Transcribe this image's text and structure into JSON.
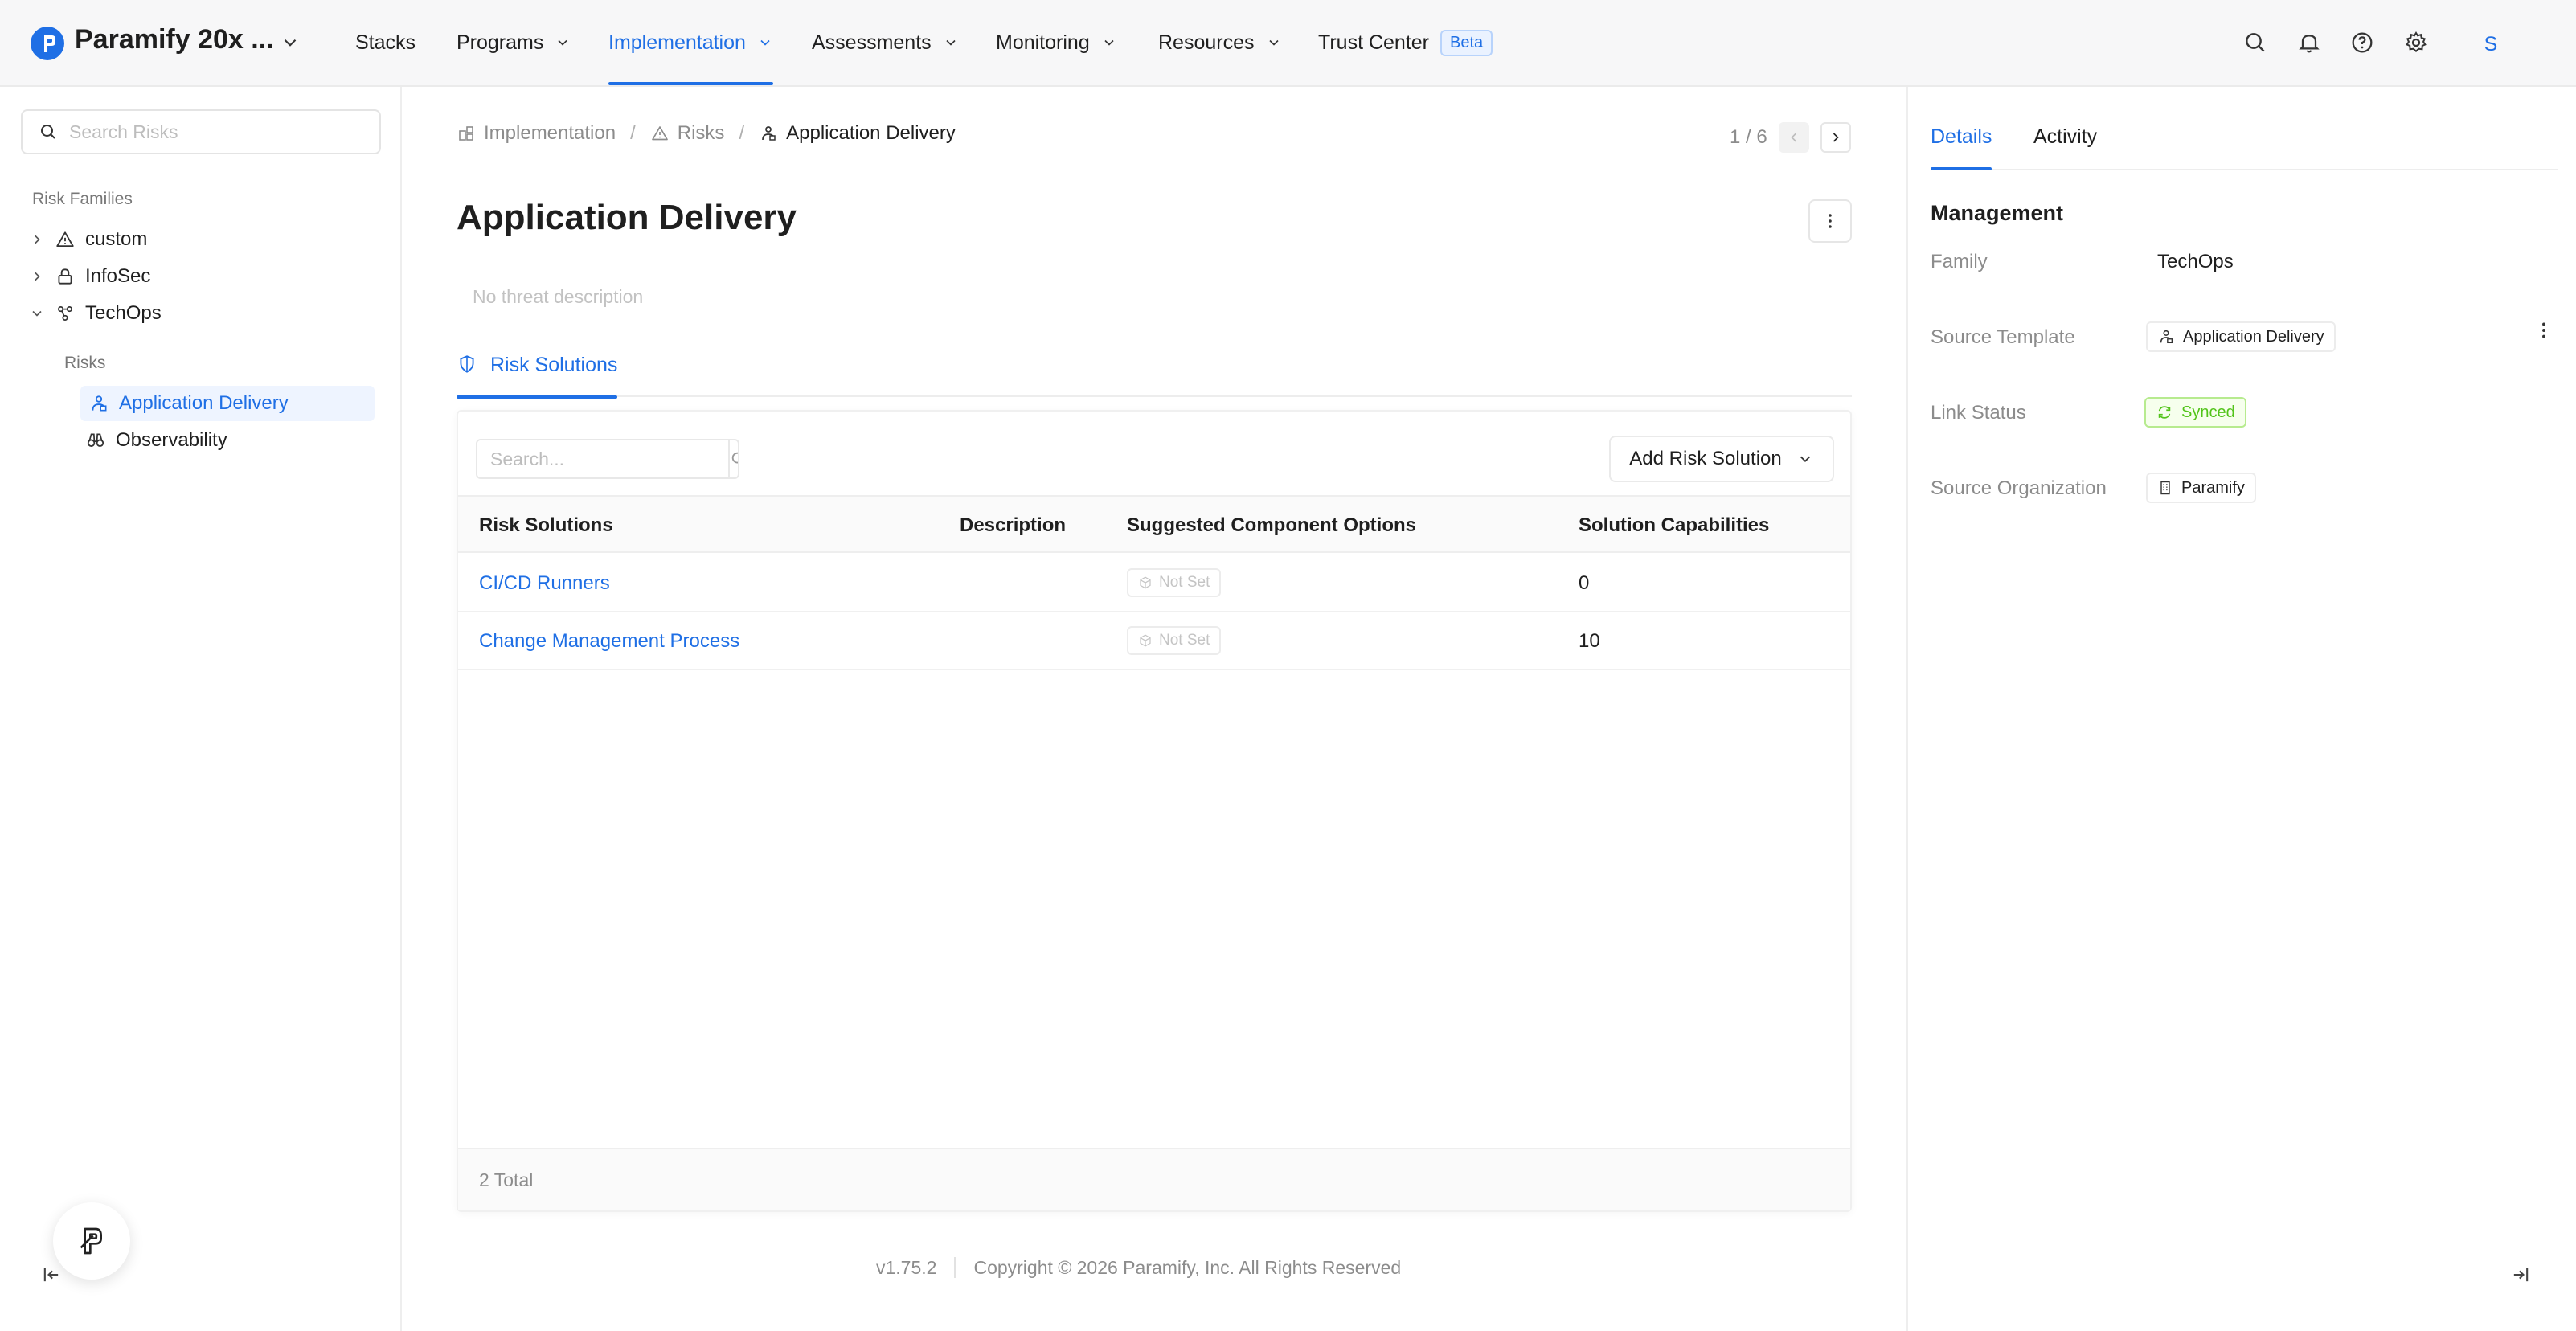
{
  "topnav": {
    "org_name": "Paramify 20x ...",
    "items": [
      {
        "label": "Stacks",
        "has_chevron": false
      },
      {
        "label": "Programs",
        "has_chevron": true
      },
      {
        "label": "Implementation",
        "has_chevron": true,
        "active": true
      },
      {
        "label": "Assessments",
        "has_chevron": true
      },
      {
        "label": "Monitoring",
        "has_chevron": true
      },
      {
        "label": "Resources",
        "has_chevron": true
      },
      {
        "label": "Trust Center",
        "badge": "Beta"
      }
    ],
    "icons": [
      "search-icon",
      "bell-icon",
      "help-icon",
      "gear-icon"
    ],
    "avatar_initial": "S"
  },
  "sidebar": {
    "search_placeholder": "Search Risks",
    "section_label": "Risk Families",
    "families": [
      {
        "label": "custom",
        "icon": "warning-triangle-icon",
        "expanded": false
      },
      {
        "label": "InfoSec",
        "icon": "lock-icon",
        "expanded": false
      },
      {
        "label": "TechOps",
        "icon": "nodes-icon",
        "expanded": true
      }
    ],
    "risks_label": "Risks",
    "risks": [
      {
        "label": "Application Delivery",
        "icon": "delivery-person-icon",
        "selected": true
      },
      {
        "label": "Observability",
        "icon": "binoculars-icon",
        "selected": false
      }
    ]
  },
  "breadcrumb": {
    "items": [
      {
        "label": "Implementation",
        "icon": "implementation-icon"
      },
      {
        "label": "Risks",
        "icon": "warning-triangle-icon"
      },
      {
        "label": "Application Delivery",
        "icon": "delivery-person-icon"
      }
    ],
    "separator": "/"
  },
  "pager": {
    "text": "1 / 6"
  },
  "main": {
    "title": "Application Delivery",
    "threat_description": "No threat description",
    "tab_label": "Risk Solutions"
  },
  "table": {
    "search_placeholder": "Search...",
    "add_button_label": "Add Risk Solution",
    "columns": [
      "Risk Solutions",
      "Description",
      "Suggested Component Options",
      "Solution Capabilities"
    ],
    "rows": [
      {
        "name": "CI/CD Runners",
        "description": "",
        "component": "Not Set",
        "capabilities": "0"
      },
      {
        "name": "Change Management Process",
        "description": "",
        "component": "Not Set",
        "capabilities": "10"
      }
    ],
    "total_label": "2 Total"
  },
  "footer": {
    "version": "v1.75.2",
    "copyright": "Copyright © 2026 Paramify, Inc. All Rights Reserved"
  },
  "details": {
    "tabs": [
      "Details",
      "Activity"
    ],
    "section_title": "Management",
    "fields": {
      "family_label": "Family",
      "family_value": "TechOps",
      "source_template_label": "Source Template",
      "source_template_value": "Application Delivery",
      "link_status_label": "Link Status",
      "link_status_value": "Synced",
      "source_org_label": "Source Organization",
      "source_org_value": "Paramify"
    }
  },
  "colors": {
    "accent": "#1f6fe5",
    "success": "#52c41a",
    "muted": "#8c8c8c"
  }
}
